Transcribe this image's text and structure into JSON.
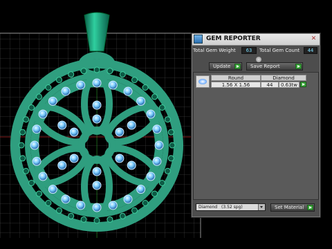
{
  "panel": {
    "title": "GEM REPORTER",
    "total_weight_label": "Total Gem Weight",
    "total_weight_value": "63",
    "total_count_label": "Total Gem Count",
    "total_count_value": "44",
    "update_label": "Update",
    "save_report_label": "Save Report",
    "table": {
      "col_round": "Round",
      "col_diamond": "Diamond",
      "row": {
        "size": "1.56 X 1.56",
        "count": "44",
        "weight": "0.63tw"
      }
    },
    "material_select": {
      "name": "Diamond",
      "sg": "(3.52 spg)"
    },
    "set_material_label": "Set Material"
  },
  "colors": {
    "metal": "#2f9e7f",
    "gem": "#77c8ff",
    "grid": "#ffffff"
  }
}
